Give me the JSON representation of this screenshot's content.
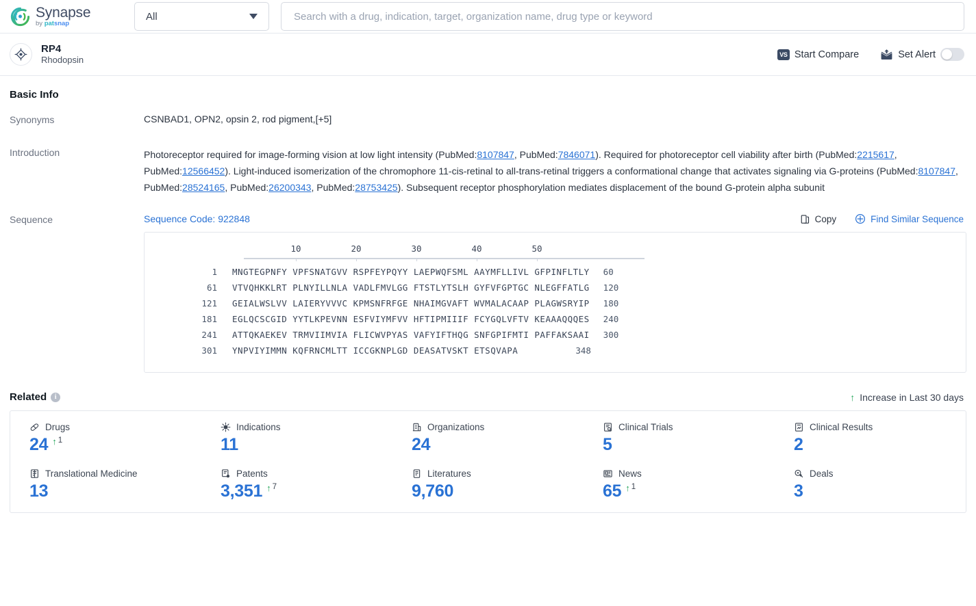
{
  "brand": {
    "name": "Synapse",
    "by": "by ",
    "pat": "pat",
    "snap": "snap"
  },
  "search": {
    "scope_value": "All",
    "placeholder": "Search with a drug, indication, target, organization name, drug type or keyword",
    "value": ""
  },
  "entity": {
    "name": "RP4",
    "alias": "Rhodopsin",
    "compare_label": "Start Compare",
    "compare_badge": "VS",
    "alert_label": "Set Alert"
  },
  "basic_info": {
    "title": "Basic Info",
    "synonyms_label": "Synonyms",
    "synonyms_value": "CSNBAD1,  OPN2,  opsin 2, rod pigment,",
    "synonyms_more": "[+5]",
    "introduction_label": "Introduction",
    "introduction_parts": [
      {
        "t": "Photoreceptor required for image-forming vision at low light intensity (PubMed:",
        "link": false
      },
      {
        "t": "8107847",
        "link": true
      },
      {
        "t": ", PubMed:",
        "link": false
      },
      {
        "t": "7846071",
        "link": true
      },
      {
        "t": "). Required for photoreceptor cell viability after birth (PubMed:",
        "link": false
      },
      {
        "t": "2215617",
        "link": true
      },
      {
        "t": ", PubMed:",
        "link": false
      },
      {
        "t": "12566452",
        "link": true
      },
      {
        "t": "). Light-induced isomerization of the chromophore 11-cis-retinal to all-trans-retinal triggers a conformational change that activates signaling via G-proteins (PubMed:",
        "link": false
      },
      {
        "t": "8107847",
        "link": true
      },
      {
        "t": ", PubMed:",
        "link": false
      },
      {
        "t": "28524165",
        "link": true
      },
      {
        "t": ", PubMed:",
        "link": false
      },
      {
        "t": "26200343",
        "link": true
      },
      {
        "t": ", PubMed:",
        "link": false
      },
      {
        "t": "28753425",
        "link": true
      },
      {
        "t": "). Subsequent receptor phosphorylation mediates displacement of the bound G-protein alpha subunit",
        "link": false
      }
    ],
    "sequence_label": "Sequence",
    "sequence_code": "Sequence Code: 922848",
    "copy_label": "Copy",
    "find_similar_label": "Find Similar Sequence"
  },
  "sequence": {
    "ruler_ticks": [
      "10",
      "20",
      "30",
      "40",
      "50"
    ],
    "rows": [
      {
        "start": "1",
        "residues": "MNGTEGPNFY VPFSNATGVV RSPFEYPQYY LAEPWQFSML AAYMFLLIVL GFPINFLTLY",
        "end": "60"
      },
      {
        "start": "61",
        "residues": "VTVQHKKLRT PLNYILLNLA VADLFMVLGG FTSTLYTSLH GYFVFGPTGC NLEGFFATLG",
        "end": "120"
      },
      {
        "start": "121",
        "residues": "GEIALWSLVV LAIERYVVVC KPMSNFRFGE NHAIMGVAFT WVMALACAAP PLAGWSRYIP",
        "end": "180"
      },
      {
        "start": "181",
        "residues": "EGLQCSCGID YYTLKPEVNN ESFVIYMFVV HFTIPMIIIF FCYGQLVFTV KEAAAQQQES",
        "end": "240"
      },
      {
        "start": "241",
        "residues": "ATTQKAEKEV TRMVIIMVIA FLICWVPYAS VAFYIFTHQG SNFGPIFMTI PAFFAKSAAI",
        "end": "300"
      },
      {
        "start": "301",
        "residues": "YNPVIYIMMN KQFRNCMLTT ICCGKNPLGD DEASATVSKT ETSQVAPA",
        "end": "348"
      }
    ]
  },
  "related": {
    "title": "Related",
    "info_glyph": "i",
    "legend": "Increase in Last 30 days",
    "legend_arrow": "↑",
    "stats": [
      {
        "label": "Drugs",
        "icon": "pill-icon",
        "value": "24",
        "delta": "1"
      },
      {
        "label": "Indications",
        "icon": "virus-icon",
        "value": "11",
        "delta": ""
      },
      {
        "label": "Organizations",
        "icon": "building-icon",
        "value": "24",
        "delta": ""
      },
      {
        "label": "Clinical Trials",
        "icon": "clinical-trial-icon",
        "value": "5",
        "delta": ""
      },
      {
        "label": "Clinical Results",
        "icon": "clinical-result-icon",
        "value": "2",
        "delta": ""
      },
      {
        "label": "Translational Medicine",
        "icon": "translational-icon",
        "value": "13",
        "delta": ""
      },
      {
        "label": "Patents",
        "icon": "patent-icon",
        "value": "3,351",
        "delta": "7"
      },
      {
        "label": "Literatures",
        "icon": "literature-icon",
        "value": "9,760",
        "delta": ""
      },
      {
        "label": "News",
        "icon": "news-icon",
        "value": "65",
        "delta": "1"
      },
      {
        "label": "Deals",
        "icon": "deal-icon",
        "value": "3",
        "delta": ""
      }
    ]
  },
  "colors": {
    "accent_blue": "#2a72d4",
    "increase_green": "#23a559",
    "brand_teal": "#2fb5c6",
    "brand_green": "#45b649"
  }
}
